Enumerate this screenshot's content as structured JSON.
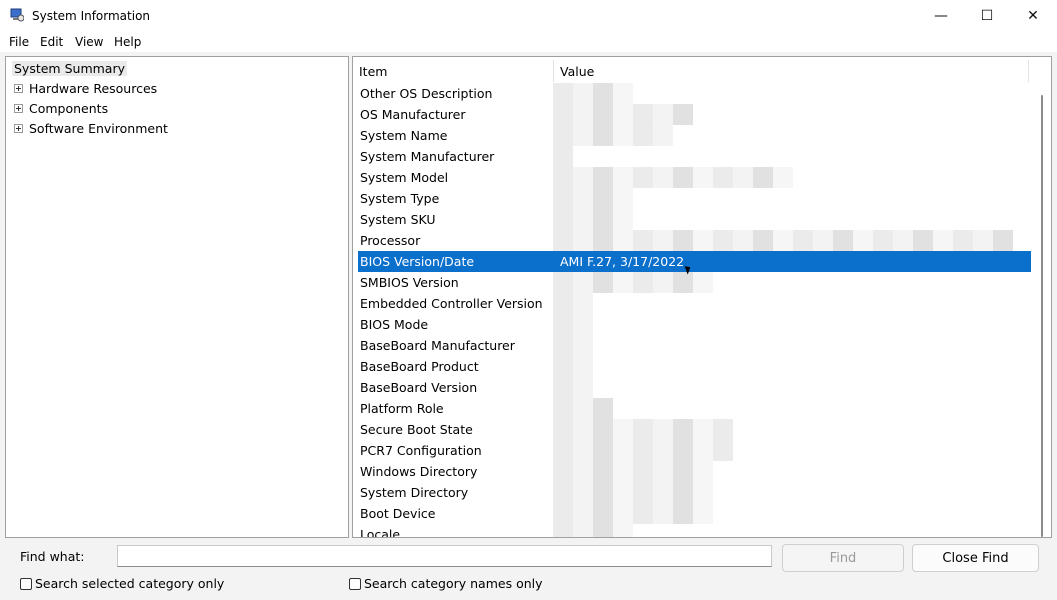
{
  "window": {
    "title": "System Information",
    "minimize": "—",
    "maximize": "☐",
    "close": "✕"
  },
  "menu": [
    "File",
    "Edit",
    "View",
    "Help"
  ],
  "tree": {
    "root": "System Summary",
    "nodes": [
      "Hardware Resources",
      "Components",
      "Software Environment"
    ]
  },
  "list": {
    "headers": {
      "item": "Item",
      "value": "Value"
    },
    "rows": [
      {
        "item": "Other OS Description",
        "value": ""
      },
      {
        "item": "OS Manufacturer",
        "value": ""
      },
      {
        "item": "System Name",
        "value": ""
      },
      {
        "item": "System Manufacturer",
        "value": ""
      },
      {
        "item": "System Model",
        "value": ""
      },
      {
        "item": "System Type",
        "value": ""
      },
      {
        "item": "System SKU",
        "value": ""
      },
      {
        "item": "Processor",
        "value": ""
      },
      {
        "item": "BIOS Version/Date",
        "value": "AMI F.27, 3/17/2022",
        "selected": true
      },
      {
        "item": "SMBIOS Version",
        "value": ""
      },
      {
        "item": "Embedded Controller Version",
        "value": ""
      },
      {
        "item": "BIOS Mode",
        "value": ""
      },
      {
        "item": "BaseBoard Manufacturer",
        "value": ""
      },
      {
        "item": "BaseBoard Product",
        "value": ""
      },
      {
        "item": "BaseBoard Version",
        "value": ""
      },
      {
        "item": "Platform Role",
        "value": ""
      },
      {
        "item": "Secure Boot State",
        "value": ""
      },
      {
        "item": "PCR7 Configuration",
        "value": ""
      },
      {
        "item": "Windows Directory",
        "value": ""
      },
      {
        "item": "System Directory",
        "value": ""
      },
      {
        "item": "Boot Device",
        "value": ""
      },
      {
        "item": "Locale",
        "value": ""
      }
    ]
  },
  "find": {
    "label": "Find what:",
    "value": "",
    "find_button": "Find",
    "close_button": "Close Find",
    "check_selected": "Search selected category only",
    "check_names": "Search category names only"
  },
  "colors": {
    "selection": "#0b6fcc"
  }
}
